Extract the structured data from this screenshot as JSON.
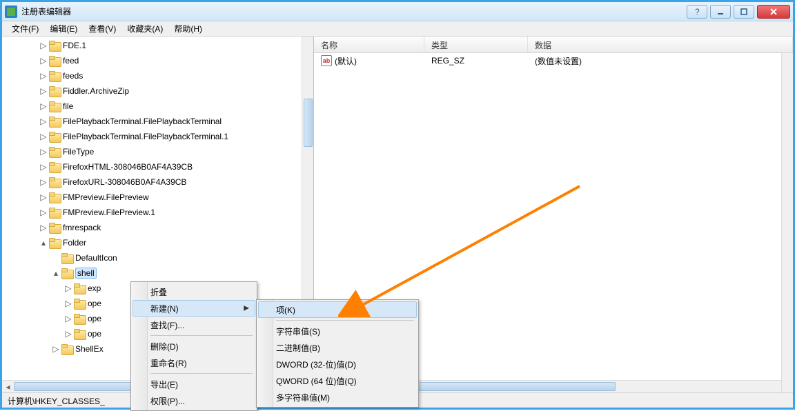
{
  "window": {
    "title": "注册表编辑器"
  },
  "menubar": [
    "文件(F)",
    "编辑(E)",
    "查看(V)",
    "收藏夹(A)",
    "帮助(H)"
  ],
  "tree": {
    "items": [
      {
        "indent": 3,
        "exp": "▷",
        "label": "FDE.1"
      },
      {
        "indent": 3,
        "exp": "▷",
        "label": "feed"
      },
      {
        "indent": 3,
        "exp": "▷",
        "label": "feeds"
      },
      {
        "indent": 3,
        "exp": "▷",
        "label": "Fiddler.ArchiveZip"
      },
      {
        "indent": 3,
        "exp": "▷",
        "label": "file"
      },
      {
        "indent": 3,
        "exp": "▷",
        "label": "FilePlaybackTerminal.FilePlaybackTerminal"
      },
      {
        "indent": 3,
        "exp": "▷",
        "label": "FilePlaybackTerminal.FilePlaybackTerminal.1"
      },
      {
        "indent": 3,
        "exp": "▷",
        "label": "FileType"
      },
      {
        "indent": 3,
        "exp": "▷",
        "label": "FirefoxHTML-308046B0AF4A39CB"
      },
      {
        "indent": 3,
        "exp": "▷",
        "label": "FirefoxURL-308046B0AF4A39CB"
      },
      {
        "indent": 3,
        "exp": "▷",
        "label": "FMPreview.FilePreview"
      },
      {
        "indent": 3,
        "exp": "▷",
        "label": "FMPreview.FilePreview.1"
      },
      {
        "indent": 3,
        "exp": "▷",
        "label": "fmrespack"
      },
      {
        "indent": 3,
        "exp": "▴",
        "label": "Folder"
      },
      {
        "indent": 4,
        "exp": "",
        "label": "DefaultIcon"
      },
      {
        "indent": 4,
        "exp": "▴",
        "label": "shell",
        "selected": true
      },
      {
        "indent": 5,
        "exp": "▷",
        "label": "exp"
      },
      {
        "indent": 5,
        "exp": "▷",
        "label": "ope"
      },
      {
        "indent": 5,
        "exp": "▷",
        "label": "ope"
      },
      {
        "indent": 5,
        "exp": "▷",
        "label": "ope"
      },
      {
        "indent": 4,
        "exp": "▷",
        "label": "ShellEx"
      }
    ]
  },
  "list": {
    "columns": {
      "name": "名称",
      "type": "类型",
      "data": "数据"
    },
    "rows": [
      {
        "name": "(默认)",
        "type": "REG_SZ",
        "data": "(数值未设置)"
      }
    ]
  },
  "context1": {
    "items": [
      {
        "label": "折叠"
      },
      {
        "label": "新建(N)",
        "arrow": true,
        "highlight": true
      },
      {
        "label": "查找(F)..."
      },
      {
        "sep": true
      },
      {
        "label": "删除(D)"
      },
      {
        "label": "重命名(R)"
      },
      {
        "sep": true
      },
      {
        "label": "导出(E)"
      },
      {
        "label": "权限(P)..."
      }
    ]
  },
  "context2": {
    "items": [
      {
        "label": "项(K)",
        "highlight": true
      },
      {
        "sep": true
      },
      {
        "label": "字符串值(S)"
      },
      {
        "label": "二进制值(B)"
      },
      {
        "label": "DWORD (32-位)值(D)"
      },
      {
        "label": "QWORD (64 位)值(Q)"
      },
      {
        "label": "多字符串值(M)"
      }
    ]
  },
  "statusbar": "计算机\\HKEY_CLASSES_",
  "icons": {
    "ab": "ab"
  }
}
